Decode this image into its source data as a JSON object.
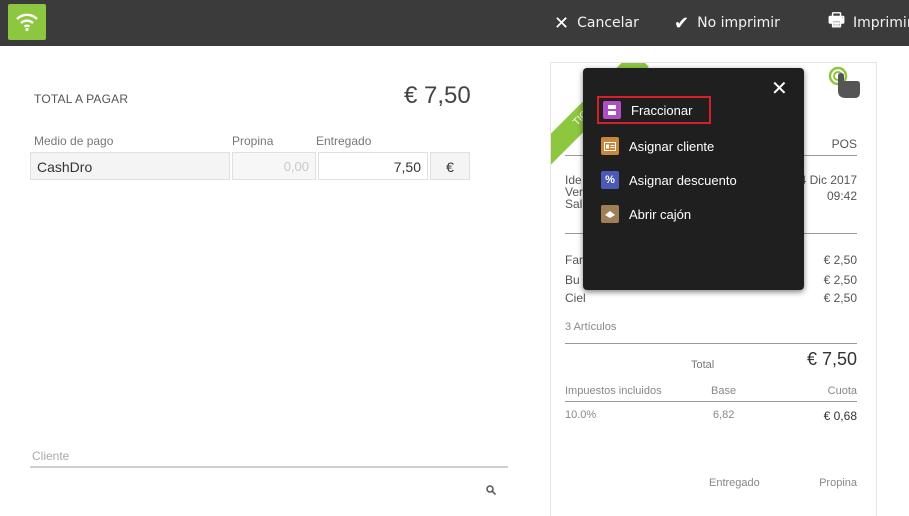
{
  "topbar": {
    "cancel_label": "Cancelar",
    "noprint_label": "No imprimir",
    "print_label": "Imprimir",
    "accent_color": "#8dc63f"
  },
  "payment": {
    "total_label": "TOTAL A PAGAR",
    "total_value": "€ 7,50",
    "headers": {
      "method": "Medio de pago",
      "tip": "Propina",
      "given": "Entregado"
    },
    "row": {
      "method": "CashDro",
      "tip": "0,00",
      "given": "7,50",
      "currency": "€"
    },
    "client_label": "Cliente"
  },
  "ticket": {
    "ribbon_text": "TICKET",
    "pos_label": "POS",
    "header_left": [
      "Ide",
      "Ver",
      "Sal"
    ],
    "date": "4 Dic 2017",
    "time": "09:42",
    "items": [
      {
        "name": "Far",
        "price": "€ 2,50"
      },
      {
        "name": "Bu",
        "price": "€ 2,50"
      },
      {
        "name": "Ciel",
        "price": "€ 2,50"
      }
    ],
    "items_count": "3 Artículos",
    "total_label": "Total",
    "total_value": "€ 7,50",
    "tax_headers": {
      "taxes": "Impuestos incluidos",
      "base": "Base",
      "quota": "Cuota"
    },
    "tax_row": {
      "rate": "10.0%",
      "base": "6,82",
      "quota": "€ 0,68"
    },
    "footer_headers": {
      "given": "Entregado",
      "tip": "Propina"
    }
  },
  "popup": {
    "items": [
      {
        "label": "Fraccionar",
        "icon": "split-icon",
        "color": "#b04fc4"
      },
      {
        "label": "Asignar cliente",
        "icon": "id-card-icon",
        "color": "#c8873a"
      },
      {
        "label": "Asignar descuento",
        "icon": "percent-icon",
        "color": "#4b5bb5"
      },
      {
        "label": "Abrir cajón",
        "icon": "drawer-icon",
        "color": "#a07e58"
      }
    ]
  }
}
